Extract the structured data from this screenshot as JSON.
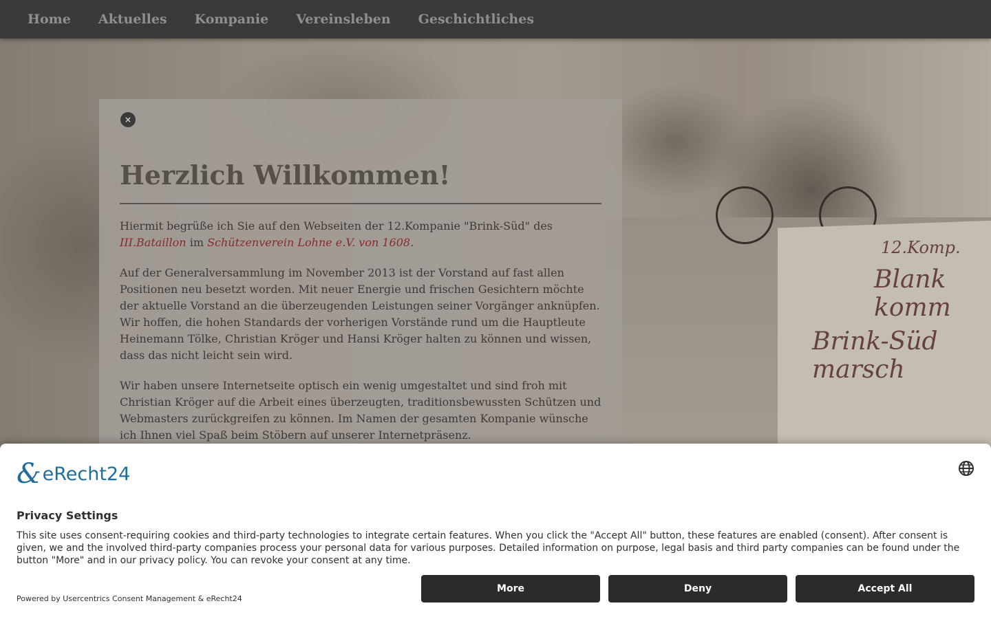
{
  "nav": {
    "items": [
      "Home",
      "Aktuelles",
      "Kompanie",
      "Vereinsleben",
      "Geschichtliches"
    ]
  },
  "background": {
    "banner_line1": "12.Komp.",
    "banner_line2": "Blank komm",
    "banner_line3": "Brink-Süd marsch"
  },
  "welcome": {
    "close_icon": "×",
    "title": "Herzlich Willkommen!",
    "p1_text1": "Hiermit begrüße ich Sie auf den Webseiten der 12.Kompanie \"Brink-Süd\" des ",
    "p1_link1": "III.Bataillon",
    "p1_text2": " im ",
    "p1_link2": "Schützenverein Lohne e.V. von 1608",
    "p1_text3": ".",
    "p2": "Auf der Generalversammlung im November 2013 ist der Vorstand auf fast allen Positionen neu besetzt worden. Mit neuer Energie und frischen Gesichtern möchte der aktuelle Vorstand an die überzeugenden Leistungen seiner Vorgänger anknüpfen. Wir hoffen, die hohen Standards der vorherigen Vorstände rund um die Hauptleute Heinemann Tölke, Christian Kröger und Hansi Kröger halten zu können und wissen, dass das nicht leicht sein wird.",
    "p3": "Wir haben unsere Internetseite optisch ein wenig umgestaltet und sind froh mit Christian Kröger auf die Arbeit eines überzeugten, traditionsbewussten Schützen und Webmasters zurückgreifen zu können. Im Namen der gesamten Kompanie wünsche ich Ihnen viel Spaß beim Stöbern auf unserer Internetpräsenz."
  },
  "consent": {
    "logo_mark": "&",
    "logo_name": "eRecht24",
    "title": "Privacy Settings",
    "description": "This site uses consent-requiring cookies and third-party technologies to integrate certain features. When you click the \"Accept All\" button, these features are enabled (consent). After consent is given, we and the involved third-party companies process your personal data for various purposes. Detailed information on purpose, legal basis and third party companies can be found under the button \"More\" and in our privacy policy. You can revoke your consent at any time.",
    "powered_by": "Powered by Usercentrics Consent Management & eRecht24",
    "buttons": {
      "more": "More",
      "deny": "Deny",
      "accept": "Accept All"
    },
    "globe_icon": "globe-icon",
    "brand_color": "#1f6d9a"
  }
}
